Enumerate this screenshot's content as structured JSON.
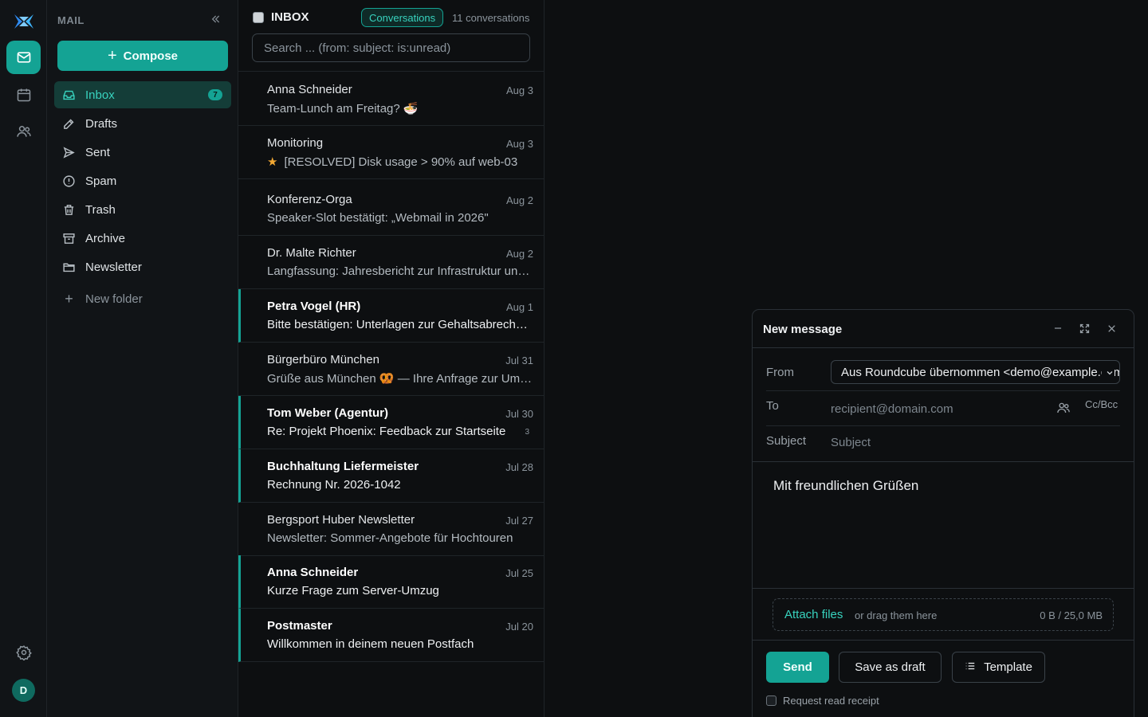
{
  "rail": {
    "items": [
      {
        "icon": "mail-icon",
        "active": true
      },
      {
        "icon": "calendar-icon",
        "active": false
      },
      {
        "icon": "contacts-icon",
        "active": false
      }
    ],
    "settings_icon": "gear-icon",
    "avatar_initial": "D"
  },
  "sidebar": {
    "section_label": "MAIL",
    "compose_label": "Compose",
    "folders": [
      {
        "label": "Inbox",
        "icon": "inbox-icon",
        "badge": "7",
        "active": true
      },
      {
        "label": "Drafts",
        "icon": "pencil-icon"
      },
      {
        "label": "Sent",
        "icon": "send-icon"
      },
      {
        "label": "Spam",
        "icon": "alert-icon"
      },
      {
        "label": "Trash",
        "icon": "trash-icon"
      },
      {
        "label": "Archive",
        "icon": "archive-icon"
      },
      {
        "label": "Newsletter",
        "icon": "folder-icon"
      }
    ],
    "new_folder_label": "New folder"
  },
  "list": {
    "title": "INBOX",
    "view_mode": "Conversations",
    "count": "11 conversations",
    "search_placeholder": "Search ... (from: subject: is:unread)",
    "messages": [
      {
        "from": "Anna Schneider",
        "date": "Aug 3",
        "subject": "Team-Lunch am Freitag? 🍜",
        "unread": false
      },
      {
        "from": "Monitoring",
        "date": "Aug 3",
        "subject": "[RESOLVED] Disk usage > 90% auf web-03",
        "unread": false,
        "starred": true
      },
      {
        "from": "Konferenz-Orga",
        "date": "Aug 2",
        "subject": "Speaker-Slot bestätigt: „Webmail in 2026\"",
        "unread": false
      },
      {
        "from": "Dr. Malte Richter",
        "date": "Aug 2",
        "subject": "Langfassung: Jahresbericht zur Infrastruktur und Betrieb",
        "unread": false
      },
      {
        "from": "Petra Vogel (HR)",
        "date": "Aug 1",
        "subject": "Bitte bestätigen: Unterlagen zur Gehaltsabrechnung",
        "unread": true
      },
      {
        "from": "Bürgerbüro München",
        "date": "Jul 31",
        "subject": "Grüße aus München 🥨 — Ihre Anfrage zur Ummeldung",
        "unread": false
      },
      {
        "from": "Tom Weber (Agentur)",
        "date": "Jul 30",
        "subject": "Re: Projekt Phoenix: Feedback zur Startseite",
        "unread": true,
        "thread_count": "3"
      },
      {
        "from": "Buchhaltung Liefermeister",
        "date": "Jul 28",
        "subject": "Rechnung Nr. 2026-1042",
        "unread": true
      },
      {
        "from": "Bergsport Huber Newsletter",
        "date": "Jul 27",
        "subject": "Newsletter: Sommer-Angebote für Hochtouren",
        "unread": false
      },
      {
        "from": "Anna Schneider",
        "date": "Jul 25",
        "subject": "Kurze Frage zum Server-Umzug",
        "unread": true
      },
      {
        "from": "Postmaster",
        "date": "Jul 20",
        "subject": "Willkommen in deinem neuen Postfach",
        "unread": true
      }
    ]
  },
  "composer": {
    "title": "New message",
    "from_label": "From",
    "from_value": "Aus Roundcube übernommen <demo@example.com>",
    "to_label": "To",
    "to_placeholder": "recipient@domain.com",
    "ccbcc_label": "Cc/Bcc",
    "subject_label": "Subject",
    "subject_placeholder": "Subject",
    "body_signature": "Mit freundlichen Grüßen",
    "attach_label": "Attach files",
    "attach_hint": "or drag them here",
    "attach_size": "0 B / 25,0 MB",
    "send_label": "Send",
    "draft_label": "Save as draft",
    "template_label": "Template",
    "receipt_label": "Request read receipt"
  },
  "colors": {
    "accent": "#14a394",
    "accent_text": "#38d3bf",
    "background": "#0d0f11",
    "star": "#f2a833"
  }
}
